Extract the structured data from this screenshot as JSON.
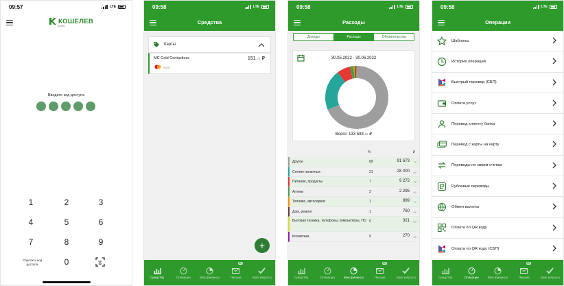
{
  "status": {
    "time1": "09:57",
    "time2": "09:58",
    "time3": "09:58",
    "time4": "09:58",
    "network": "LTE"
  },
  "login": {
    "logo_text": "КОШЕЛЕВ",
    "logo_sub": "БАНК",
    "code_label": "Введите код доступа",
    "keys": [
      "1",
      "2",
      "3",
      "4",
      "5",
      "6",
      "7",
      "8",
      "9",
      "0"
    ],
    "reset_label": "Сбросить код доступа"
  },
  "cards": {
    "title": "Средства",
    "section_label": "Карты",
    "card_name": "MC Gold Contactless",
    "card_amount": "151",
    "card_kop": "71",
    "currency": "₽",
    "card_mask": "*6021"
  },
  "expenses": {
    "title": "Расходы",
    "segments": [
      "Доходы",
      "Расходы",
      "Обязательства"
    ],
    "date_range": "30.05.2022 - 30.06.2022",
    "total_label": "Всего:",
    "total_value": "133 593",
    "total_kop": "69",
    "currency": "₽",
    "col_percent": "%",
    "col_currency": "₽",
    "rows": [
      {
        "name": "Другое",
        "pct": "69",
        "amount": "91 673",
        "kop": "72",
        "color": "#9e9e9e"
      },
      {
        "name": "Снятие наличных",
        "pct": "21",
        "amount": "28 000",
        "kop": "00",
        "color": "#26a69a"
      },
      {
        "name": "Питание, продукты",
        "pct": "7",
        "amount": "9 272",
        "kop": "76",
        "color": "#e53935"
      },
      {
        "name": "Аптеки",
        "pct": "2",
        "amount": "2 295",
        "kop": "60",
        "color": "#43a047"
      },
      {
        "name": "Топливо, автосервис",
        "pct": "1",
        "amount": "999",
        "kop": "77",
        "color": "#fb8c00"
      },
      {
        "name": "Дом, ремонт",
        "pct": "1",
        "amount": "760",
        "kop": "00",
        "color": "#5d4037"
      },
      {
        "name": "Бытовая техника, телефоны, компьютеры, ПО",
        "pct": "0",
        "amount": "321",
        "kop": "00",
        "color": "#cddc39"
      },
      {
        "name": "Косметика",
        "pct": "0",
        "amount": "270",
        "kop": "89",
        "color": "#8e24aa"
      }
    ]
  },
  "operations": {
    "title": "Операции",
    "items": [
      {
        "label": "Шаблоны",
        "icon": "star-icon"
      },
      {
        "label": "История операций",
        "icon": "clock-icon"
      },
      {
        "label": "Быстрый перевод (СБП)",
        "icon": "sbp-icon"
      },
      {
        "label": "Оплата услуг",
        "icon": "wallet-icon"
      },
      {
        "label": "Перевод клиенту банка",
        "icon": "person-icon"
      },
      {
        "label": "Перевод с карты на карту",
        "icon": "cards-icon"
      },
      {
        "label": "Переводы по своим счетам",
        "icon": "exchange-icon"
      },
      {
        "label": "Рублевые переводы",
        "icon": "ruble-icon"
      },
      {
        "label": "Обмен валюты",
        "icon": "globe-icon"
      },
      {
        "label": "Оплата по QR коду",
        "icon": "qr-icon"
      },
      {
        "label": "Оплата по QR коду (СБП)",
        "icon": "sbp-icon"
      }
    ]
  },
  "tabs": [
    {
      "label": "Средства",
      "icon": "chart-icon"
    },
    {
      "label": "Операции",
      "icon": "gauge-icon"
    },
    {
      "label": "Мои финансы",
      "icon": "pie-icon"
    },
    {
      "label": "Письма",
      "icon": "mail-icon",
      "badge": "50"
    },
    {
      "label": "Мои запросы",
      "icon": "check-icon"
    }
  ],
  "colors": {
    "brand_green": "#2e9a2c",
    "pin_dot": "#5e9c6a"
  }
}
